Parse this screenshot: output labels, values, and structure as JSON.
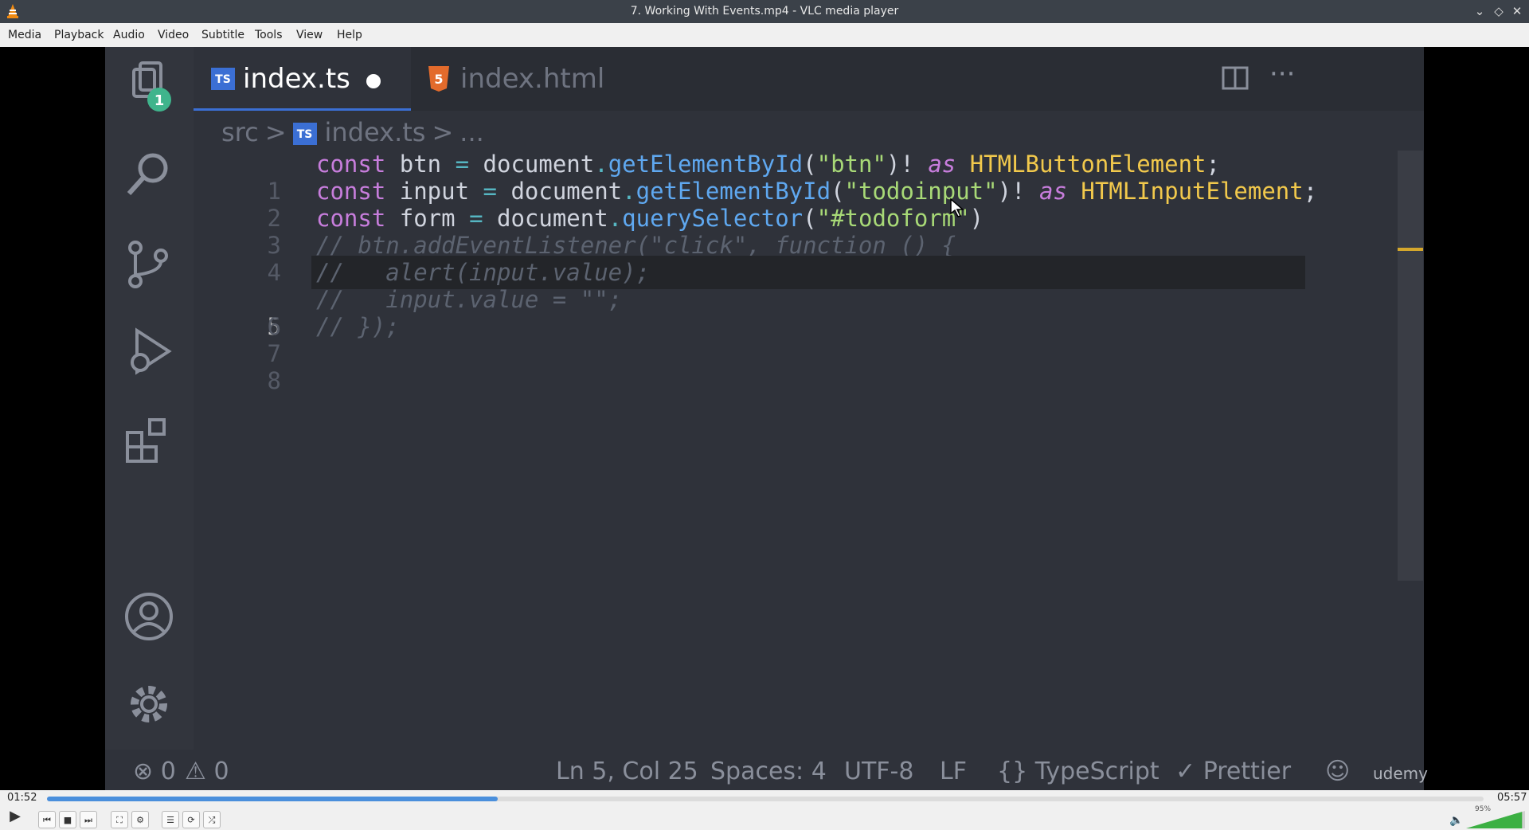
{
  "window": {
    "title": "7. Working With Events.mp4 - VLC media player"
  },
  "menu": [
    "Media",
    "Playback",
    "Audio",
    "Video",
    "Subtitle",
    "Tools",
    "View",
    "Help"
  ],
  "video": {
    "tabs": [
      {
        "label": "index.ts",
        "badge": "TS",
        "modified": true
      },
      {
        "label": "index.html",
        "badge": "5"
      }
    ],
    "explorer_badge": "1",
    "breadcrumb": {
      "folder": "src",
      "file": "index.ts",
      "more": "..."
    },
    "code_lines": [
      {
        "num": "1"
      },
      {
        "num": "2"
      },
      {
        "num": "3"
      },
      {
        "num": "4"
      },
      {
        "num": "5"
      },
      {
        "num": "6"
      },
      {
        "num": "7"
      },
      {
        "num": "8"
      }
    ],
    "code": {
      "l1": {
        "a": "const ",
        "b": "btn",
        "c": " = ",
        "d": "document",
        "e": ".",
        "f": "getElementById",
        "g": "(",
        "h": "\"btn\"",
        "i": ")! ",
        "j": "as",
        "k": " ",
        "l": "HTMLButtonElement",
        "m": ";"
      },
      "l2": {
        "a": "const ",
        "b": "input",
        "c": " = ",
        "d": "document",
        "e": ".",
        "f": "getElementById",
        "g": "(",
        "h": "\"todoinput\"",
        "i": ")! ",
        "j": "as",
        "k": " ",
        "l": "HTMLInputElement",
        "m": ";"
      },
      "l3": {
        "a": "const ",
        "b": "form",
        "c": " = ",
        "d": "document",
        "e": ".",
        "f": "querySelector",
        "g": "(",
        "h": "\"#todoform\"",
        "i": ")"
      },
      "l4": "// btn.addEventListener(\"click\", function () {",
      "l5": "//   alert(input.value);",
      "l6": "//   input.value = \"\";",
      "l7": "// });"
    },
    "status": {
      "errors": "0",
      "warnings": "0",
      "position": "Ln 5, Col 25",
      "spaces": "Spaces: 4",
      "encoding": "UTF-8",
      "eol": "LF",
      "language": "TypeScript",
      "prettier": "Prettier",
      "watermark": "udemy"
    }
  },
  "player": {
    "elapsed": "01:52",
    "total": "05:57",
    "progress": 0.314,
    "volume_label": "95%",
    "volume": 0.95
  },
  "colors": {
    "accent": "#4a8fdc",
    "ts_blue": "#3b6fd4",
    "html_orange": "#e36b2c"
  }
}
